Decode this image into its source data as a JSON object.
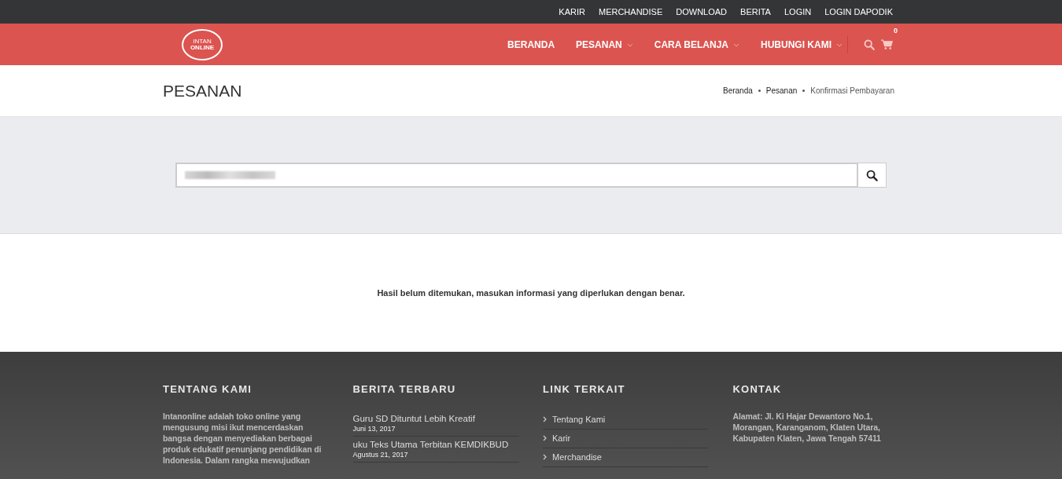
{
  "top_bar": {
    "links": [
      "KARIR",
      "MERCHANDISE",
      "DOWNLOAD",
      "BERITA",
      "LOGIN",
      "LOGIN DAPODIK"
    ]
  },
  "logo": {
    "line_1": "INTAN",
    "line_2": "ONLINE"
  },
  "nav": {
    "items": [
      {
        "label": "BERANDA",
        "has_dropdown": false
      },
      {
        "label": "PESANAN",
        "has_dropdown": true
      },
      {
        "label": "CARA BELANJA",
        "has_dropdown": true
      },
      {
        "label": "HUBUNGI KAMI",
        "has_dropdown": true
      }
    ],
    "cart_count": "0"
  },
  "page_header": {
    "title": "PESANAN",
    "breadcrumb": [
      "Beranda",
      "Pesanan",
      "Konfirmasi Pembayaran"
    ]
  },
  "search": {
    "value_redacted": true
  },
  "message": "Hasil belum ditemukan, masukan informasi yang diperlukan dengan benar.",
  "footer": {
    "about": {
      "heading": "TENTANG KAMI",
      "text": "Intanonline adalah toko online yang mengusung misi ikut mencerdaskan bangsa dengan menyediakan berbagai produk edukatif penunjang pendidikan di Indonesia. Dalam rangka mewujudkan"
    },
    "news": {
      "heading": "BERITA TERBARU",
      "items": [
        {
          "title": "Guru SD Dituntut Lebih Kreatif",
          "date": "Juni 13, 2017"
        },
        {
          "title": "uku Teks Utama Terbitan KEMDIKBUD",
          "date": "Agustus 21, 2017"
        }
      ]
    },
    "links": {
      "heading": "LINK TERKAIT",
      "items": [
        "Tentang Kami",
        "Karir",
        "Merchandise"
      ]
    },
    "contact": {
      "heading": "KONTAK",
      "text": "Alamat: Jl. Ki Hajar Dewantoro No.1, Morangan, Karanganom, Klaten Utara, Kabupaten Klaten, Jawa Tengah 57411"
    }
  }
}
